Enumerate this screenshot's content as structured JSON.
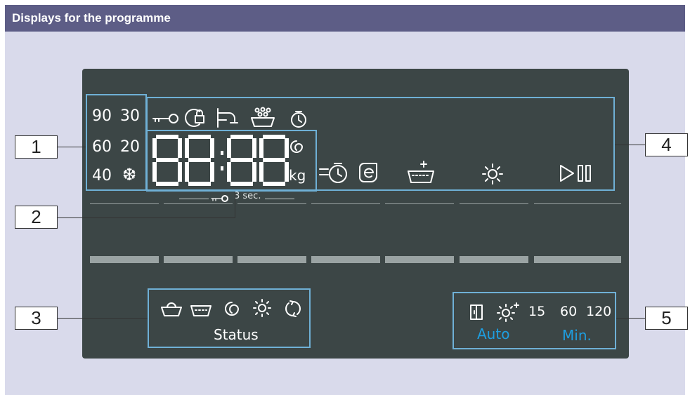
{
  "header": {
    "title": "Displays for the programme"
  },
  "callouts": [
    "1",
    "2",
    "3",
    "4",
    "5"
  ],
  "temperatures": {
    "t90": "90",
    "t30": "30",
    "t60": "60",
    "t20": "20",
    "t40": "40",
    "cold": "❆"
  },
  "display": {
    "digits": "88:88",
    "unit": "kg",
    "lock_hint": "3 sec."
  },
  "status": {
    "label": "Status"
  },
  "options": {
    "t15": "15",
    "t60": "60",
    "t120": "120",
    "auto": "Auto",
    "min": "Min."
  },
  "colors": {
    "panel": "#3c4646",
    "frame": "#6fb0d6",
    "accent": "#1e9ee0",
    "header": "#5d5d86",
    "background": "#d9daeb"
  },
  "icons": {
    "box1": [],
    "box2": [
      "spin-icon"
    ],
    "box4_top": [
      "child-lock-key-icon",
      "door-lock-icon",
      "water-tap-icon",
      "foam-icon",
      "timer-icon"
    ],
    "box4_bottom": [
      "ready-in-time-icon",
      "eco-icon",
      "additional-rinse-icon",
      "drying-icon",
      "start-pause-icon"
    ],
    "box3": [
      "wash-icon",
      "rinse-icon",
      "spin-icon",
      "drying-icon",
      "finish-icon"
    ],
    "box5": [
      "door-icon",
      "drying-plus-icon"
    ]
  }
}
